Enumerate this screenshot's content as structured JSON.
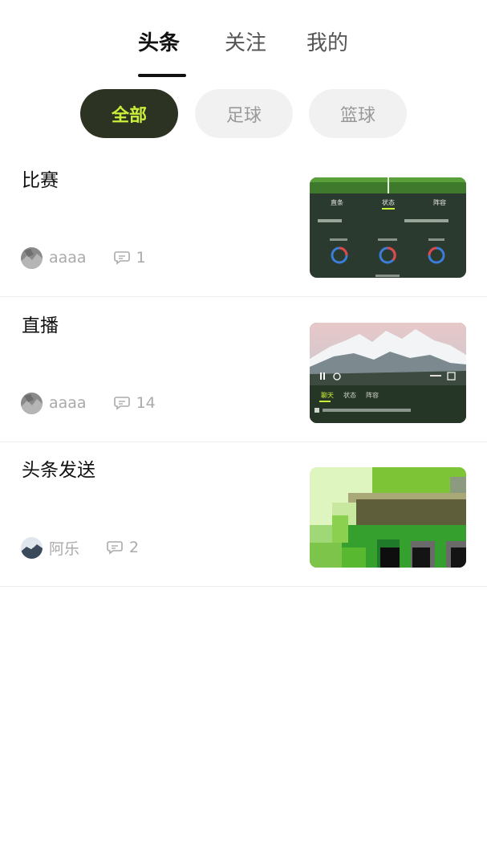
{
  "tabs": [
    {
      "label": "头条",
      "active": true
    },
    {
      "label": "关注",
      "active": false
    },
    {
      "label": "我的",
      "active": false
    }
  ],
  "filters": [
    {
      "label": "全部",
      "active": true
    },
    {
      "label": "足球",
      "active": false
    },
    {
      "label": "篮球",
      "active": false
    }
  ],
  "posts": [
    {
      "title": "比赛",
      "author": "aaaa",
      "comments": "1",
      "thumb": "match-stats-screenshot",
      "thumb_texts": {
        "tab1": "直条",
        "tab2": "状态",
        "tab3": "阵容"
      }
    },
    {
      "title": "直播",
      "author": "aaaa",
      "comments": "14",
      "thumb": "mountain-live-video",
      "thumb_texts": {
        "chat": "聊天",
        "state": "状态",
        "lineup": "阵容"
      }
    },
    {
      "title": "头条发送",
      "author": "阿乐",
      "comments": "2",
      "thumb": "pixelated-green-image"
    }
  ],
  "colors": {
    "chip_active_bg": "#2d3322",
    "chip_active_text": "#c9ef3a",
    "muted_text": "#aaaaaa"
  }
}
